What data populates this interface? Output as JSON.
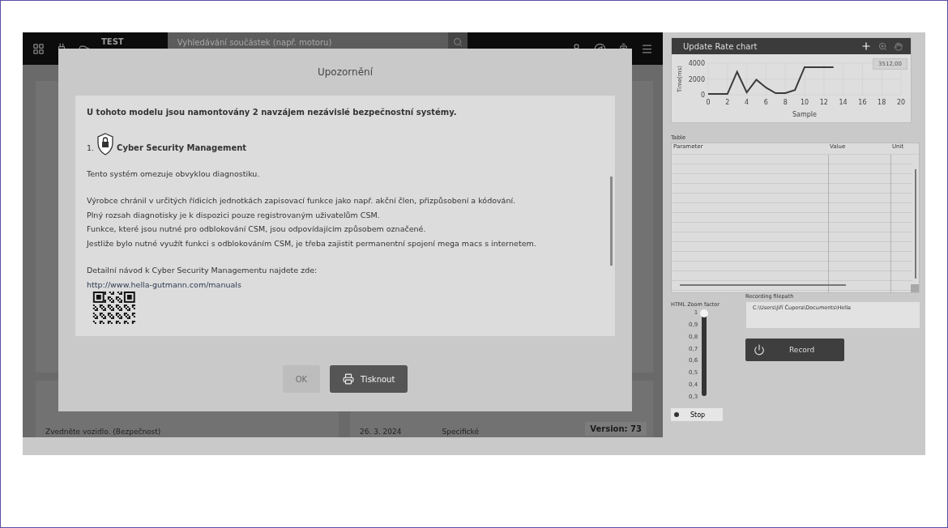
{
  "topbar": {
    "title": "TEST",
    "search": {
      "placeholder": "Vyhledávání součástek (např. motoru)"
    }
  },
  "background": {
    "row": {
      "description": "Zvedněte vozidlo. (Bezpečnost)",
      "date": "26. 3. 2024",
      "type": "Specifické"
    },
    "version": "Version: 73"
  },
  "dialog": {
    "title": "Upozornění",
    "intro": "U tohoto modelu jsou namontovány 2 navzájem nezávislé bezpečnostní systémy.",
    "sections": [
      {
        "number": "1.",
        "heading": "Cyber Security Management"
      }
    ],
    "blocks": [
      [
        {
          "kind": "text",
          "text": "Tento systém omezuje obvyklou diagnostiku."
        }
      ],
      [
        {
          "kind": "text",
          "text": "Výrobce chránil v určitých řídicích jednotkách zapisovací funkce jako např. akční člen, přizpůsobení a kódování."
        },
        {
          "kind": "text",
          "text": "Plný rozsah diagnotisky je k dispozici pouze registrovaným uživatelům CSM."
        },
        {
          "kind": "text",
          "text": "Funkce, které jsou nutné pro odblokování CSM, jsou odpovídajícím způsobem označené."
        },
        {
          "kind": "text",
          "text": "Jestliže bylo nutné využít funkci s odblokováním CSM, je třeba zajistit permanentní spojení mega macs s internetem."
        }
      ],
      [
        {
          "kind": "text",
          "text": "Detailní návod k Cyber Security Managementu najdete zde:"
        },
        {
          "kind": "link",
          "text": "http://www.hella-gutmann.com/manuals"
        }
      ]
    ],
    "buttons": [
      {
        "label": "OK",
        "kind": "confirm",
        "disabled": true
      },
      {
        "label": "Tisknout",
        "kind": "print",
        "disabled": false
      }
    ]
  },
  "chart_panel": {
    "title": "Update Rate chart",
    "readout": "3512,00",
    "chart_data": {
      "type": "line",
      "xlabel": "Sample",
      "ylabel": "Time(ms)",
      "x": [
        0,
        1,
        2,
        3,
        4,
        5,
        6,
        7,
        8,
        9,
        10,
        11,
        12,
        13
      ],
      "grid": true,
      "series": [
        {
          "color": "#3a3a3a",
          "values": [
            100,
            100,
            100,
            2900,
            300,
            1900,
            900,
            200,
            200,
            600,
            3500,
            3500,
            3500,
            3500
          ]
        }
      ],
      "xlim": [
        0,
        20
      ],
      "ylim": [
        0,
        4000
      ],
      "xticks": [
        0,
        2,
        4,
        6,
        8,
        10,
        12,
        14,
        16,
        18,
        20
      ],
      "yticks": [
        0,
        2000,
        4000
      ]
    }
  },
  "table": {
    "label": "Table",
    "columns": [
      "Parameter",
      "Value",
      "Unit"
    ]
  },
  "zoom": {
    "label": "HTML Zoom factor",
    "ticks": [
      "1",
      "0,9",
      "0,8",
      "0,7",
      "0,6",
      "0,5",
      "0,4",
      "0,3"
    ],
    "level": 1
  },
  "recording": {
    "label": "Recording filepath",
    "value": "C:\\Users\\Jiří Čupera\\Documents\\Hella",
    "record_button": "Record",
    "stop_button": "Stop"
  }
}
